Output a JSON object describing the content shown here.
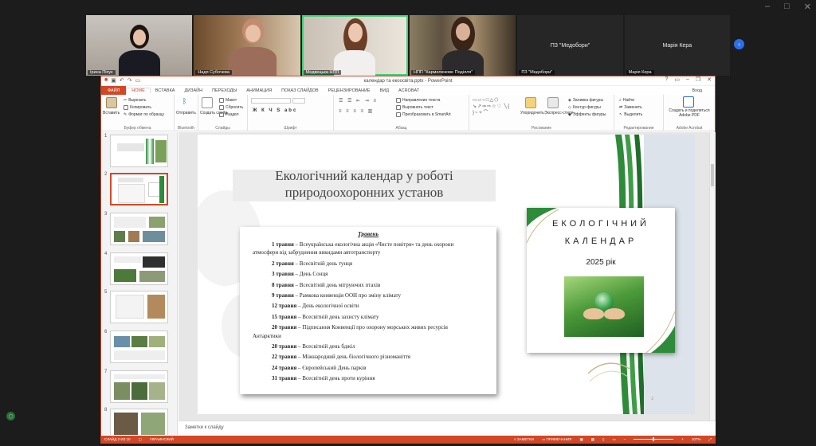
{
  "participants": [
    {
      "caption": "Ірина Піпук",
      "active": false
    },
    {
      "caption": "Надя Субочева",
      "active": false
    },
    {
      "caption": "Медвецька НПП",
      "active": true
    },
    {
      "caption": "НПП \"Кармелюкове Поділля\"",
      "active": false
    },
    {
      "caption": "ПЗ \"Медобори\"",
      "center": "ПЗ \"Медобори\""
    },
    {
      "caption": "Марія Кера",
      "center": "Марія Кера"
    }
  ],
  "ppt": {
    "title": "календар та екоосвіта.pptx - PowerPoint",
    "menu": {
      "file": "ФАЙЛ",
      "tabs": [
        "HOME",
        "ВСТАВКА",
        "ДИЗАЙН",
        "ПЕРЕХОДЫ",
        "АНИМАЦИЯ",
        "ПОКАЗ СЛАЙДОВ",
        "РЕЦЕНЗИРОВАНИЕ",
        "ВИД",
        "ACROBAT"
      ],
      "login": "Вход"
    },
    "ribbon": {
      "paste": "Вставить",
      "cut": "Вырезать",
      "copy": "Копировать",
      "format_painter": "Формат по образцу",
      "clipboard_label": "Буфер обмена",
      "send": "Отправить",
      "bluetooth_label": "Bluetooth",
      "new_slide": "Создать слайд",
      "layout": "Макет",
      "reset": "Сбросить",
      "section": "Раздел",
      "slides_label": "Слайды",
      "font_label": "Шрифт",
      "text_direction": "Направление текста",
      "align_text": "Выровнять текст",
      "smartart": "Преобразовать в SmartArt",
      "paragraph_label": "Абзац",
      "arrange": "Упорядочить",
      "quick_styles": "Экспресс-стили",
      "shape_fill": "Заливка фигуры",
      "shape_outline": "Контур фигуры",
      "shape_effects": "Эффекты фигуры",
      "drawing_label": "Рисование",
      "find": "Найти",
      "replace": "Заменить",
      "select": "Выделить",
      "editing_label": "Редактирование",
      "create_pdf": "Создать и поделиться Adobe PDF",
      "acrobat_label": "Adobe Acrobat"
    },
    "thumb_numbers": [
      "1",
      "2",
      "3",
      "4",
      "5",
      "6",
      "7",
      "8"
    ],
    "slide": {
      "title_line1": "Екологічний календар у роботі",
      "title_line2": "природоохоронних установ",
      "card_heading": "Травень",
      "events": [
        {
          "date": "1 травня",
          "text": " – Всеукраїнська екологічна акція «Чисте повітря» та день охорони",
          "cont": "атмосфери від забруднення викидами автотранспорту"
        },
        {
          "date": "2 травня",
          "text": " – Всесвітній день тунця"
        },
        {
          "date": "3 травня",
          "text": " – День Сонця"
        },
        {
          "date": "8 травня",
          "text": " – Всесвітній день мігруючих птахів"
        },
        {
          "date": "9 травня",
          "text": " – Рамкова конвенція ООН про зміну клімату"
        },
        {
          "date": "12 травня",
          "text": " – День екологічної освіти"
        },
        {
          "date": "15 травня",
          "text": " – Всесвітній день захисту клімату"
        },
        {
          "date": "20 травня",
          "text": " – Підписання Конвенції про охорону морських живих ресурсів",
          "cont": "Антарктики"
        },
        {
          "date": "20 травня",
          "text": " – Всесвітній день бджіл"
        },
        {
          "date": "22 травня",
          "text": " – Міжнародний день біологічного різноманіття"
        },
        {
          "date": "24 травня",
          "text": " – Європейський День парків"
        },
        {
          "date": "31 травня",
          "text": " – Всесвітній день проти куріння"
        }
      ],
      "cal_line1": "ЕКОЛОГІЧНИЙ",
      "cal_line2": "КАЛЕНДАР",
      "cal_year": "2025 рік",
      "page_no": "2"
    },
    "notes_placeholder": "Заметки к слайду",
    "status": {
      "slide": "СЛАЙД 2 ИЗ 10",
      "lang": "УКРАИНСКИЙ",
      "notes": "ЗАМЕТКИ",
      "comments": "ПРИМЕЧАНИЯ",
      "zoom": "107%"
    }
  },
  "colors": {
    "accent": "#d24726",
    "active_speaker": "#3bd16f",
    "green": "#2e8b3a"
  }
}
